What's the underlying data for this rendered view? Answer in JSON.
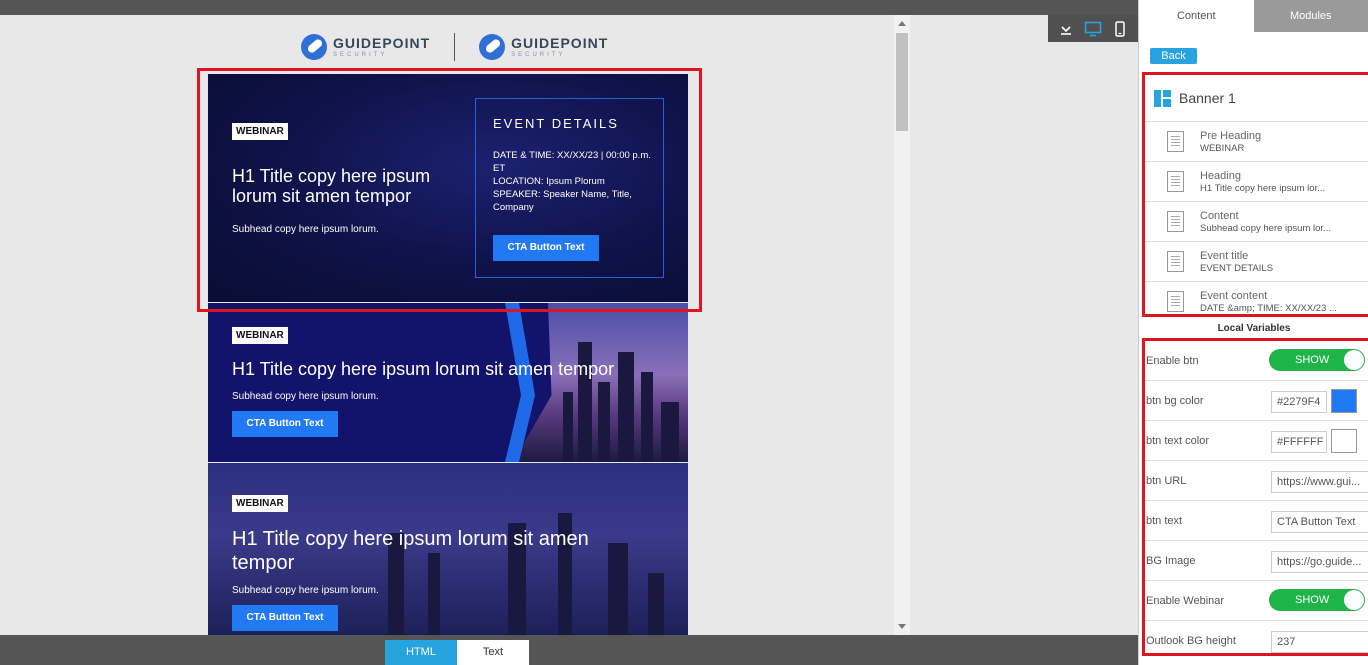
{
  "canvas": {
    "logos": [
      {
        "name": "GUIDEPOINT",
        "sub": "SECURITY"
      },
      {
        "name": "GUIDEPOINT",
        "sub": "SECURITY"
      }
    ],
    "banner1": {
      "tag": "WEBINAR",
      "heading": "H1 Title copy here ipsum lorum sit amen tempor",
      "subhead": "Subhead copy here ipsum lorum.",
      "event_title": "EVENT DETAILS",
      "event_lines": [
        "DATE & TIME: XX/XX/23 | 00:00 p.m. ET",
        "LOCATION: Ipsum Plorum",
        "SPEAKER: Speaker Name, Title, Company"
      ],
      "cta": "CTA Button Text"
    },
    "banner2": {
      "tag": "WEBINAR",
      "heading": "H1 Title copy here ipsum lorum sit amen tempor",
      "subhead": "Subhead copy here ipsum lorum.",
      "cta": "CTA Button Text"
    },
    "banner3": {
      "tag": "WEBINAR",
      "heading": "H1 Title copy here ipsum lorum sit amen tempor",
      "subhead": "Subhead copy here ipsum lorum.",
      "cta": "CTA Button Text"
    }
  },
  "bottom_tabs": {
    "html": "HTML",
    "text": "Text"
  },
  "device_icons": [
    "collapse-icon",
    "desktop-icon",
    "mobile-icon"
  ],
  "panel": {
    "tabs": {
      "content": "Content",
      "modules": "Modules"
    },
    "back": "Back",
    "banner_name": "Banner 1",
    "layers": [
      {
        "title": "Pre Heading",
        "value": "WEBINAR"
      },
      {
        "title": "Heading",
        "value": "H1 Title copy here ipsum lor..."
      },
      {
        "title": "Content",
        "value": "Subhead copy here ipsum lor..."
      },
      {
        "title": "Event title",
        "value": "EVENT DETAILS"
      },
      {
        "title": "Event content",
        "value": "DATE &amp; TIME: XX/XX/23 ..."
      }
    ],
    "local_vars_title": "Local Variables",
    "vars": {
      "enable_btn": {
        "label": "Enable btn",
        "value": "SHOW"
      },
      "btn_bg_color": {
        "label": "btn bg color",
        "value": "#2279F4"
      },
      "btn_text_color": {
        "label": "btn text color",
        "value": "#FFFFFF"
      },
      "btn_url": {
        "label": "btn URL",
        "value": "https://www.gui..."
      },
      "btn_text": {
        "label": "btn text",
        "value": "CTA Button Text"
      },
      "bg_image": {
        "label": "BG Image",
        "value": "https://go.guide..."
      },
      "enable_webinar": {
        "label": "Enable Webinar",
        "value": "SHOW"
      },
      "outlook_bg_height": {
        "label": "Outlook BG height",
        "value": "237"
      }
    }
  },
  "colors": {
    "accent": "#27a4e0",
    "cta": "#2279F4",
    "highlight": "#e0141e",
    "toggle": "#1fb44a"
  }
}
